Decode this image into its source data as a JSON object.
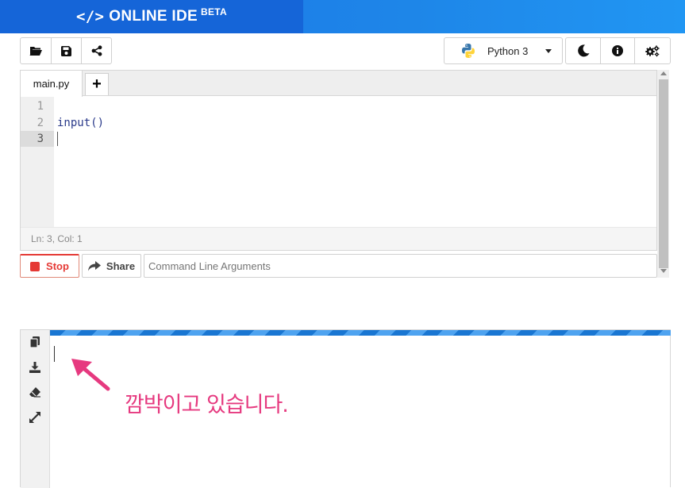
{
  "header": {
    "brand_code": "</>",
    "brand_name": "ONLINE IDE",
    "brand_tag": "BETA"
  },
  "toolbar": {
    "left": [
      "open-folder-icon",
      "save-icon",
      "share-icon"
    ],
    "language": "Python 3",
    "right": [
      "moon-icon",
      "info-icon",
      "settings-icon"
    ]
  },
  "editor": {
    "tabs": [
      {
        "label": "main.py"
      }
    ],
    "add_tab_label": "+",
    "line_numbers": [
      "1",
      "2",
      "3"
    ],
    "lines": [
      "",
      "input()",
      ""
    ],
    "active_line": 3,
    "status": "Ln: 3,  Col: 1"
  },
  "run": {
    "stop_label": "Stop",
    "share_label": "Share",
    "args_placeholder": "Command Line Arguments"
  },
  "output": {
    "side_icons": [
      "copy-icon",
      "download-icon",
      "eraser-icon",
      "expand-icon"
    ]
  },
  "annotation": {
    "text": "깜박이고 있습니다.",
    "color": "#e6397f"
  },
  "colors": {
    "brand": "#1565d8",
    "accent": "#1a73e8",
    "stop": "#e53935",
    "annotation": "#e6397f"
  }
}
